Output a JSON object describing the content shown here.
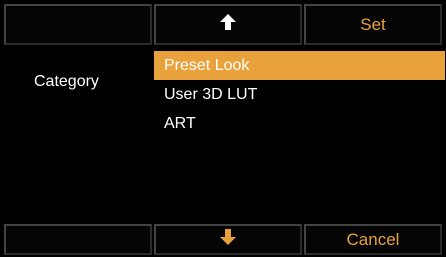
{
  "left_panel": {
    "label": "Category"
  },
  "softkeys": {
    "top_left": "",
    "up_icon": "arrow-up-icon",
    "set_label": "Set",
    "bottom_left": "",
    "down_icon": "arrow-down-icon",
    "cancel_label": "Cancel"
  },
  "list": {
    "selected_index": 0,
    "items": [
      "Preset Look",
      "User 3D LUT",
      "ART"
    ]
  },
  "colors": {
    "accent": "#e9a23b",
    "up_arrow": "#ffffff",
    "down_arrow": "#e9a23b",
    "background": "#000000"
  }
}
